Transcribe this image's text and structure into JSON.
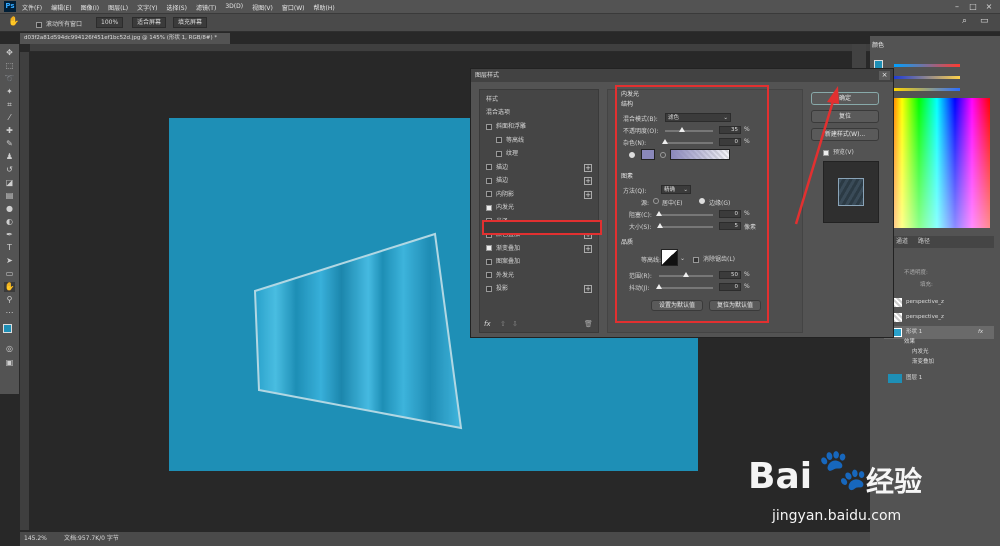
{
  "app": {
    "logo": "Ps",
    "menus": [
      "文件(F)",
      "编辑(E)",
      "图像(I)",
      "图层(L)",
      "文字(Y)",
      "选择(S)",
      "滤镜(T)",
      "3D(D)",
      "视图(V)",
      "窗口(W)",
      "帮助(H)"
    ]
  },
  "options": {
    "scroll_all": "滚动所有窗口",
    "zoom_value": "100%",
    "fit_screen": "适合屏幕",
    "fill_screen": "填充屏幕"
  },
  "document": {
    "tab_title": "d03f2a81d594dc994126f451ef1bc52d.jpg @ 145% (形状 1, RGB/8#) *"
  },
  "status": {
    "zoom": "145.2%",
    "doc_info": "文档:957.7K/0 字节"
  },
  "dialog": {
    "title": "图层样式",
    "styles_header": "样式",
    "blend_options": "混合选项",
    "items": [
      {
        "label": "斜面和浮雕",
        "checked": false,
        "plus": false
      },
      {
        "label": "等高线",
        "checked": false,
        "plus": false
      },
      {
        "label": "纹理",
        "checked": false,
        "plus": false
      },
      {
        "label": "描边",
        "checked": false,
        "plus": true
      },
      {
        "label": "描边",
        "checked": false,
        "plus": true
      },
      {
        "label": "内阴影",
        "checked": false,
        "plus": true
      },
      {
        "label": "内发光",
        "checked": true,
        "plus": false
      },
      {
        "label": "光泽",
        "checked": false,
        "plus": false
      },
      {
        "label": "颜色叠加",
        "checked": false,
        "plus": true
      },
      {
        "label": "渐变叠加",
        "checked": true,
        "plus": true
      },
      {
        "label": "图案叠加",
        "checked": false,
        "plus": false
      },
      {
        "label": "外发光",
        "checked": false,
        "plus": false
      },
      {
        "label": "投影",
        "checked": false,
        "plus": true
      }
    ],
    "fx_label": "fx",
    "panel": {
      "title": "内发光",
      "structure": "结构",
      "blend_mode_label": "混合模式(B):",
      "blend_mode_value": "滤色",
      "opacity_label": "不透明度(O):",
      "opacity_value": "35",
      "opacity_pct": 0.35,
      "noise_label": "杂色(N):",
      "noise_value": "0",
      "noise_pct": 0,
      "elements": "图素",
      "technique_label": "方法(Q):",
      "technique_value": "精确",
      "source_label": "源:",
      "source_center": "居中(E)",
      "source_edge": "边缘(G)",
      "choke_label": "阻塞(C):",
      "choke_value": "0",
      "choke_pct": 0,
      "size_label": "大小(S):",
      "size_value": "5",
      "size_unit": "像素",
      "size_pct": 0.02,
      "quality": "品质",
      "contour_label": "等高线:",
      "antialias_label": "消除锯齿(L)",
      "range_label": "范围(R):",
      "range_value": "50",
      "range_pct": 0.5,
      "jitter_label": "抖动(J):",
      "jitter_value": "0",
      "jitter_pct": 0,
      "pct": "%",
      "set_default": "设置为默认值",
      "reset_default": "复位为默认值"
    },
    "ok": "确定",
    "reset": "复位",
    "new_style": "新建样式(W)...",
    "preview": "预览(V)"
  },
  "right_panel": {
    "color_tab": "颜色",
    "channels_tab": "通道",
    "paths_tab": "路径",
    "opacity_label": "不透明度:",
    "fill_label": "填充:",
    "layers": [
      {
        "name": "perspective_z",
        "type": "img"
      },
      {
        "name": "perspective_z",
        "type": "img"
      },
      {
        "name": "形状 1",
        "type": "shape",
        "fx": "fx"
      },
      {
        "name": "效果",
        "type": "sub"
      },
      {
        "name": "内发光",
        "type": "sub2"
      },
      {
        "name": "渐变叠加",
        "type": "sub2"
      },
      {
        "name": "图层 1",
        "type": "fill"
      }
    ]
  },
  "watermark": {
    "brand": "Bai",
    "brand2": "经验",
    "url": "jingyan.baidu.com"
  },
  "colors": {
    "canvas": "#1e8fb6",
    "accent_red": "#e23030"
  }
}
